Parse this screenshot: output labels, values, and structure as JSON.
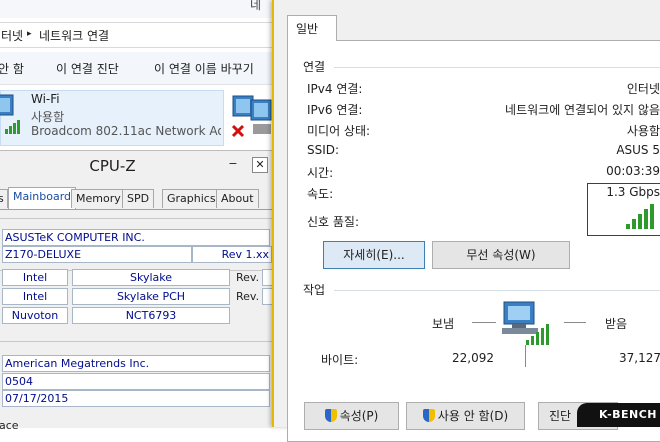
{
  "background_window": {
    "title_tail": "네",
    "breadcrumb": [
      "터넷",
      "네트워크 연결"
    ],
    "toolbar": [
      "안 함",
      "이 연결 진단",
      "이 연결 이름 바꾸기"
    ],
    "wifi": {
      "name": "Wi-Fi",
      "status": "사용함",
      "adapter": "Broadcom 802.11ac Network Ad..."
    }
  },
  "cpuz": {
    "title": "CPU-Z",
    "minimize": "−",
    "close": "✕",
    "tabs": [
      "s",
      "Mainboard",
      "Memory",
      "SPD",
      "Graphics",
      "About"
    ],
    "active_tab": "Mainboard",
    "manufacturer": "ASUSTeK COMPUTER INC.",
    "model": "Z170-DELUXE",
    "model_rev": "Rev 1.xx",
    "chipset": {
      "vendor": "Intel",
      "name": "Skylake",
      "rev_label": "Rev."
    },
    "southbridge": {
      "vendor": "Intel",
      "name": "Skylake PCH",
      "rev_label": "Rev."
    },
    "lpcio": {
      "vendor": "Nuvoton",
      "name": "NCT6793"
    },
    "bios_brand": "American Megatrends Inc.",
    "bios_version": "0504",
    "bios_date": "07/17/2015",
    "bottom_cut": "ace"
  },
  "dialog": {
    "tab": "일반",
    "connection_group": "연결",
    "rows": [
      {
        "label": "IPv4 연결:",
        "value": "인터넷"
      },
      {
        "label": "IPv6 연결:",
        "value": "네트워크에 연결되어 있지 않음"
      },
      {
        "label": "미디어 상태:",
        "value": "사용함"
      },
      {
        "label": "SSID:",
        "value": "ASUS 5"
      },
      {
        "label": "시간:",
        "value": "00:03:39"
      },
      {
        "label": "속도:",
        "value": "1.3 Gbps"
      }
    ],
    "signal_label": "신호 품질:",
    "signal_bars": 5,
    "details_button": "자세히(E)...",
    "wireless_button": "무선 속성(W)",
    "activity_group": "작업",
    "sent_label": "보냄",
    "received_label": "받음",
    "bytes_label": "바이트:",
    "bytes_sent": "22,092",
    "bytes_received": "37,127",
    "properties_button": "속성(P)",
    "disable_button": "사용 안 함(D)",
    "diagnose_button": "진단",
    "accent_color": "#e4b700",
    "highlight_color": "#d30000"
  },
  "watermark": "K-BENCH"
}
